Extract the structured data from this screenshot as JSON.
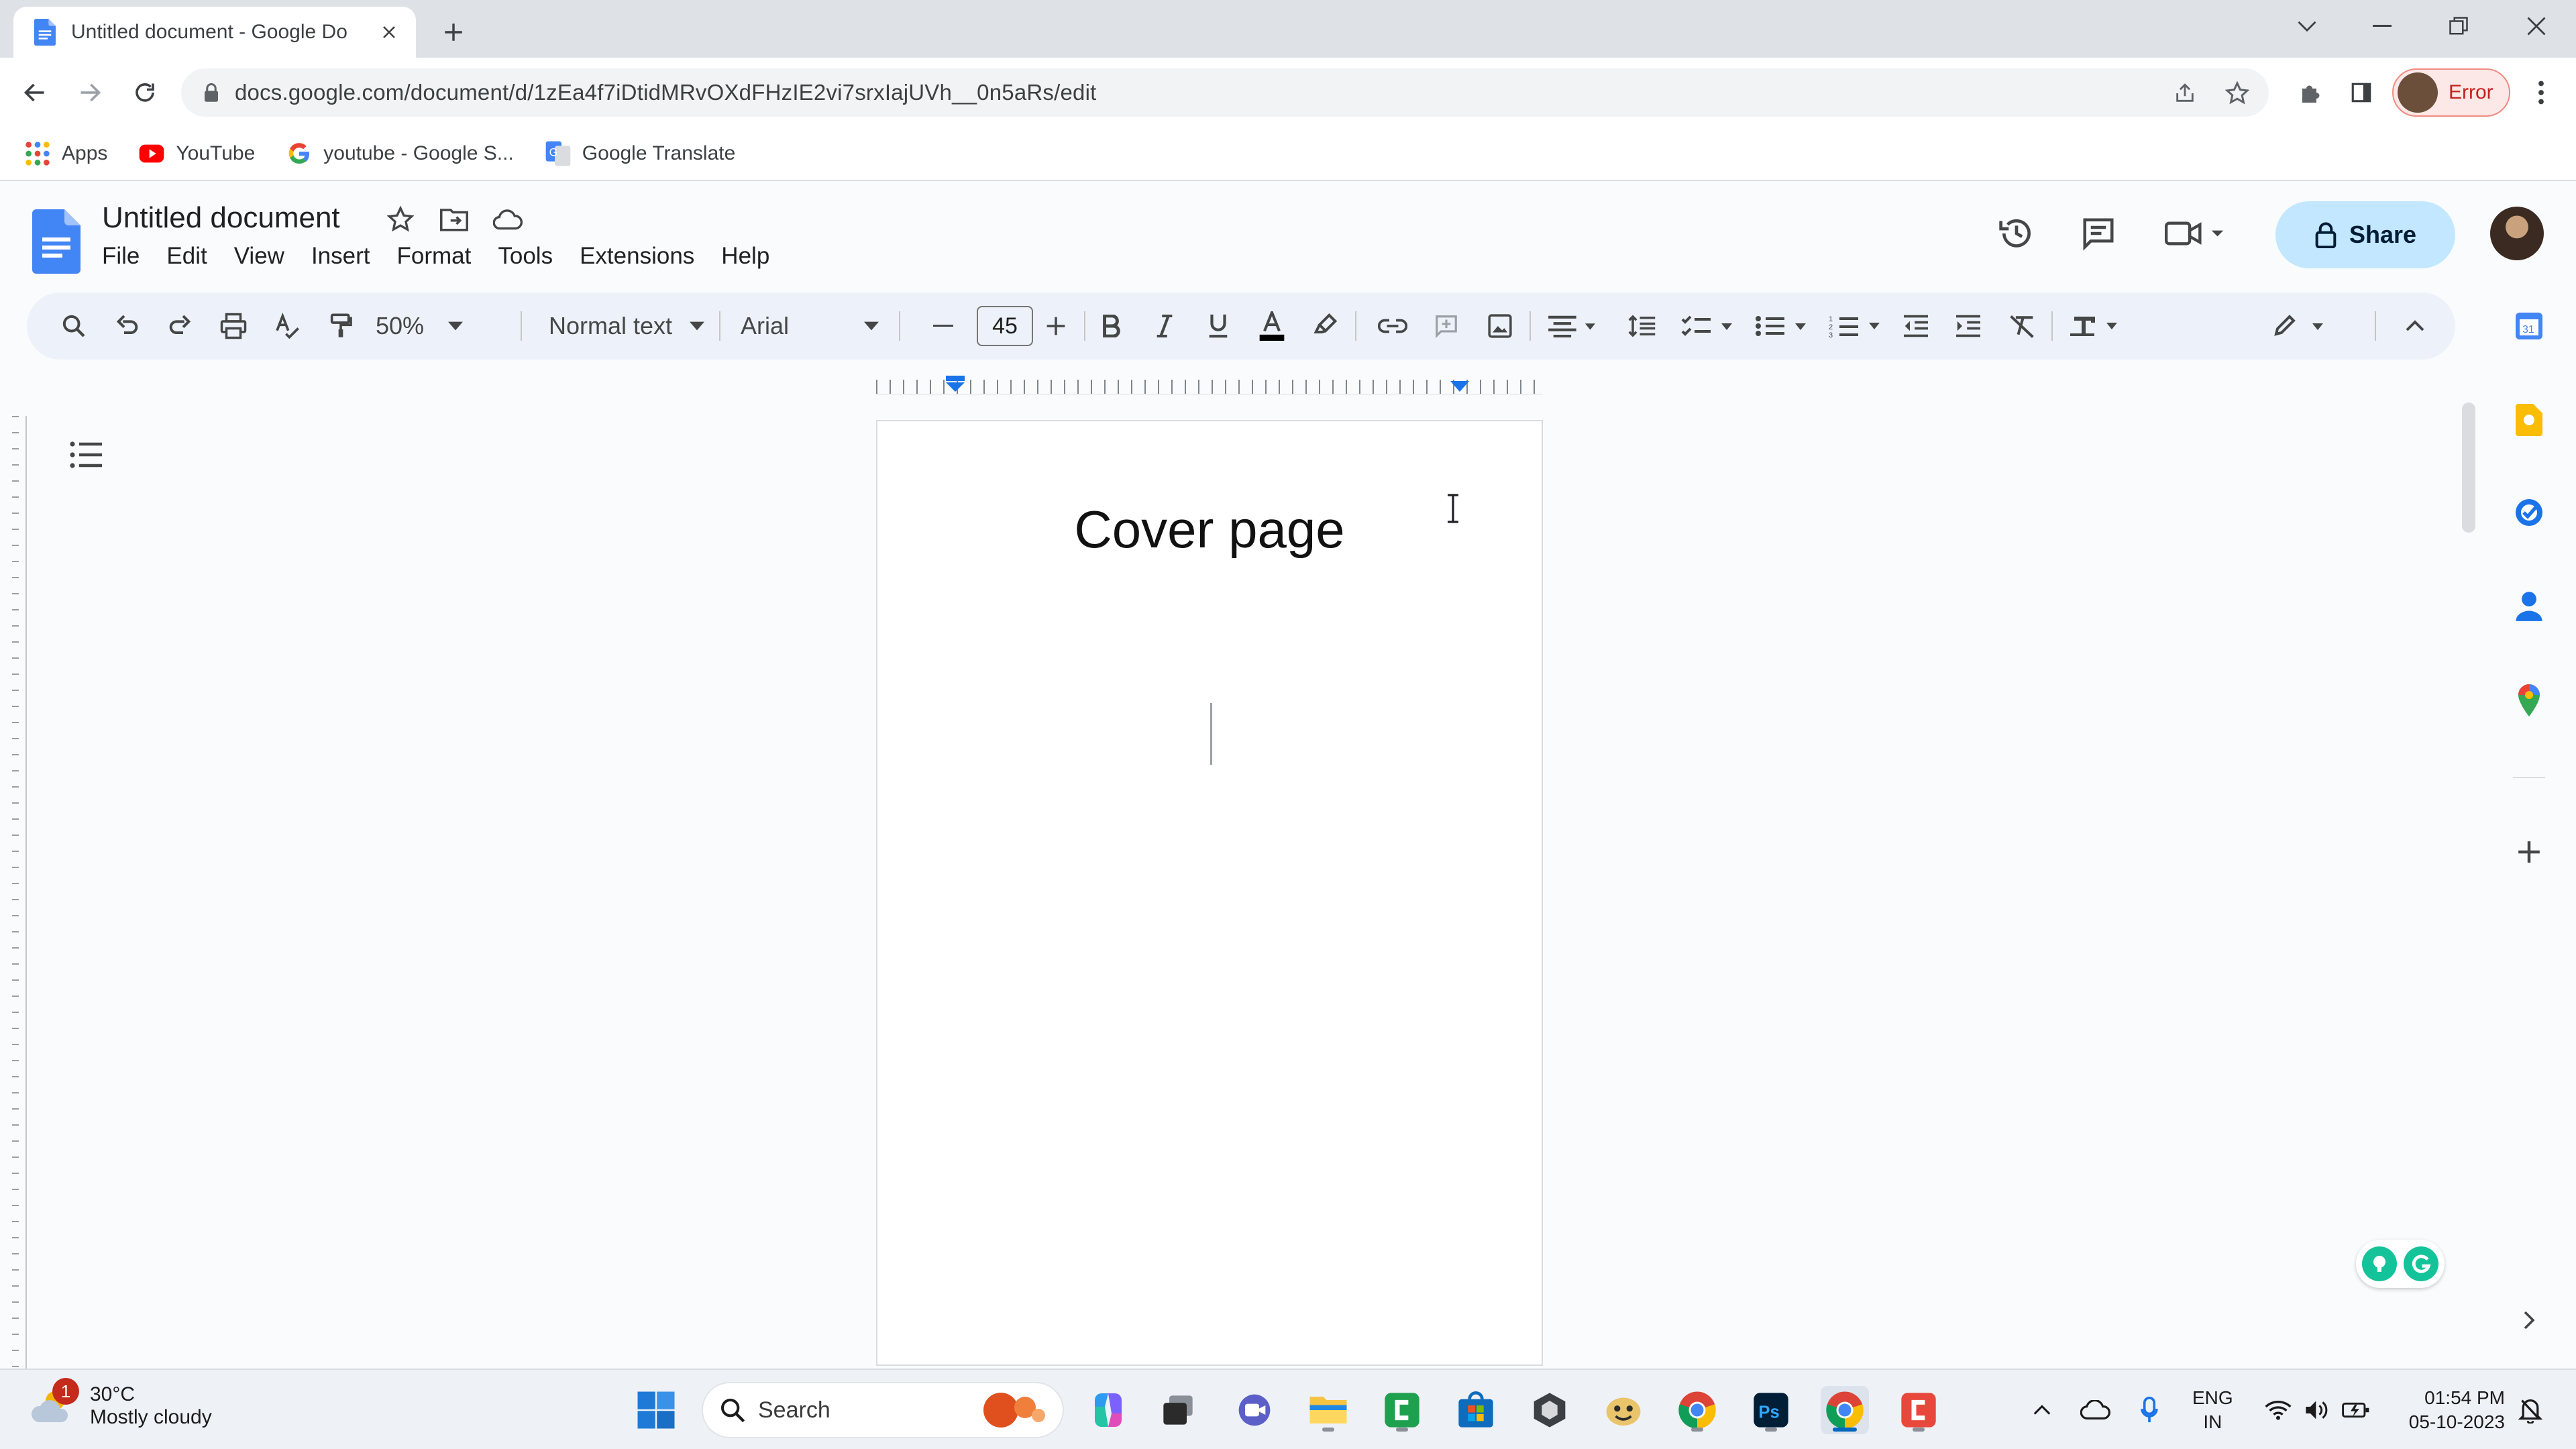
{
  "browser": {
    "tab_title": "Untitled document - Google Do",
    "url": "docs.google.com/document/d/1zEa4f7iDtidMRvOXdFHzIE2vi7srxIajUVh__0n5aRs/edit",
    "profile_status": "Error",
    "bookmarks": [
      {
        "label": "Apps",
        "icon": "apps-grid-icon"
      },
      {
        "label": "YouTube",
        "icon": "youtube-icon"
      },
      {
        "label": "youtube - Google S...",
        "icon": "google-icon"
      },
      {
        "label": "Google Translate",
        "icon": "google-translate-icon"
      }
    ]
  },
  "docs": {
    "title": "Untitled document",
    "menu": [
      "File",
      "Edit",
      "View",
      "Insert",
      "Format",
      "Tools",
      "Extensions",
      "Help"
    ],
    "share_label": "Share",
    "toolbar": {
      "zoom": "50%",
      "style": "Normal text",
      "font": "Arial",
      "font_size": "45"
    }
  },
  "page": {
    "heading": "Cover page"
  },
  "taskbar": {
    "weather_temp": "30°C",
    "weather_condition": "Mostly cloudy",
    "weather_alert_count": "1",
    "search_label": "Search",
    "language_line1": "ENG",
    "language_line2": "IN",
    "time": "01:54 PM",
    "date": "05-10-2023"
  },
  "colors": {
    "docs_blue": "#4285f4",
    "share_bg": "#c2e7ff",
    "toolbar_bg": "#edf2fa",
    "tabstrip_bg": "#dee1e6",
    "error_red": "#c5221f"
  }
}
